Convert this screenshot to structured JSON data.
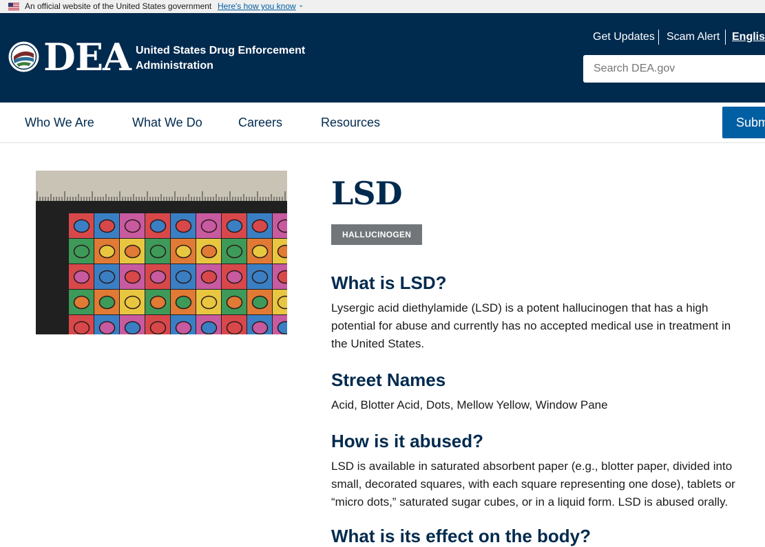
{
  "gov_banner": {
    "text": "An official website of the United States government",
    "link": "Here's how you know"
  },
  "header": {
    "logo": "DEA",
    "agency_name": "United States Drug Enforcement Administration",
    "utility_links": [
      "Get Updates",
      "Scam Alert",
      "English"
    ],
    "search_placeholder": "Search DEA.gov"
  },
  "nav": {
    "items": [
      "Who We Are",
      "What We Do",
      "Careers",
      "Resources"
    ],
    "submit_label": "Subm"
  },
  "colors": {
    "header_bg": "#002a4e",
    "accent_blue": "#005ea2",
    "badge_gray": "#71767a"
  },
  "article": {
    "title": "LSD",
    "badge": "HALLUCINOGEN",
    "sections": [
      {
        "heading": "What is LSD?",
        "lines": [
          "Lysergic acid diethylamide (LSD) is a potent hallucinogen that has a high",
          "potential for abuse and currently has no accepted medical use in treatment in",
          "the United States."
        ]
      },
      {
        "heading": "Street Names",
        "lines": [
          "Acid, Blotter Acid, Dots, Mellow Yellow, Window Pane"
        ]
      },
      {
        "heading": "How is it abused?",
        "lines": [
          "LSD is available in saturated absorbent paper (e.g., blotter paper, divided into",
          "small, decorated squares, with each square representing one dose), tablets or",
          "“micro dots,” saturated sugar cubes, or in a liquid form. LSD is abused orally."
        ]
      },
      {
        "heading": "What is its effect on the body?",
        "lines": []
      }
    ]
  }
}
